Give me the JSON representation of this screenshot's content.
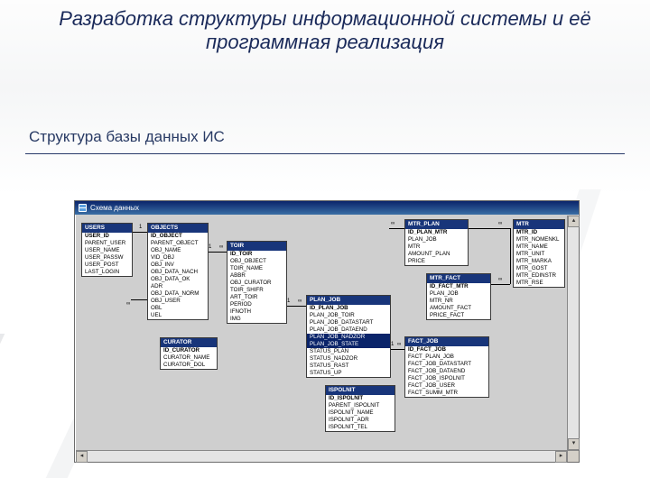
{
  "title": "Разработка структуры информационной системы и её программная реализация",
  "subtitle": "Структура базы данных ИС",
  "window": {
    "caption": "Схема данных"
  },
  "tables": {
    "users": {
      "name": "USERS",
      "fields": [
        "USER_ID",
        "PARENT_USER",
        "USER_NAME",
        "USER_PASSW",
        "USER_POST",
        "LAST_LOGIN"
      ]
    },
    "objects": {
      "name": "OBJECTS",
      "fields": [
        "ID_OBJECT",
        "PARENT_OBJECT",
        "OBJ_NAME",
        "VID_OBJ",
        "OBJ_INV",
        "OBJ_DATA_NACH",
        "OBJ_DATA_OK",
        "ADR",
        "OBJ_DATA_NORM",
        "OBJ_USER",
        "OBL",
        "UEL"
      ]
    },
    "toir": {
      "name": "TOIR",
      "fields": [
        "ID_TOIR",
        "OBJ_OBJECT",
        "TOIR_NAME",
        "ABBR",
        "OBJ_CURATOR",
        "TOIR_SHIFR",
        "ART_TOIR",
        "PERIOD",
        "IFNOTH",
        "IMG"
      ]
    },
    "curator": {
      "name": "CURATOR",
      "fields": [
        "ID_CURATOR",
        "CURATOR_NAME",
        "CURATOR_DOL"
      ]
    },
    "plan_job": {
      "name": "PLAN_JOB",
      "fields": [
        "ID_PLAN_JOB",
        "PLAN_JOB_TOIR",
        "PLAN_JOB_DATASTART",
        "PLAN_JOB_DATAEND",
        "PLAN_JOB_NADZOR",
        "PLAN_JOB_STATE",
        "STATUS_PLAN",
        "STATUS_NADZOR",
        "STATUS_RAST",
        "STATUS_UP"
      ]
    },
    "ispolnit": {
      "name": "ISPOLNIT",
      "fields": [
        "ID_ISPOLNIT",
        "PARENT_ISPOLNIT",
        "ISPOLNIT_NAME",
        "ISPOLNIT_ADR",
        "ISPOLNIT_TEL"
      ]
    },
    "mtr_plan": {
      "name": "MTR_PLAN",
      "fields": [
        "ID_PLAN_MTR",
        "PLAN_JOB",
        "MTR",
        "AMOUNT_PLAN",
        "PRICE"
      ]
    },
    "mtr_fact": {
      "name": "MTR_FACT",
      "fields": [
        "ID_FACT_MTR",
        "PLAN_JOB",
        "MTR_NR",
        "AMOUNT_FACT",
        "PRICE_FACT"
      ]
    },
    "fact_job": {
      "name": "FACT_JOB",
      "fields": [
        "ID_FACT_JOB",
        "FACT_PLAN_JOB",
        "FACT_JOB_DATASTART",
        "FACT_JOB_DATAEND",
        "FACT_JOB_ISPOLNIT",
        "FACT_JOB_USER",
        "FACT_SUMM_MTR"
      ]
    },
    "mtr": {
      "name": "MTR",
      "fields": [
        "MTR_ID",
        "MTR_NOMENKL",
        "MTR_NAME",
        "MTR_UNIT",
        "MTR_MARKA",
        "MTR_GOST",
        "MTR_EDINSTR",
        "MTR_RSE"
      ]
    }
  },
  "cardinality": {
    "one": "1",
    "many": "∞"
  }
}
